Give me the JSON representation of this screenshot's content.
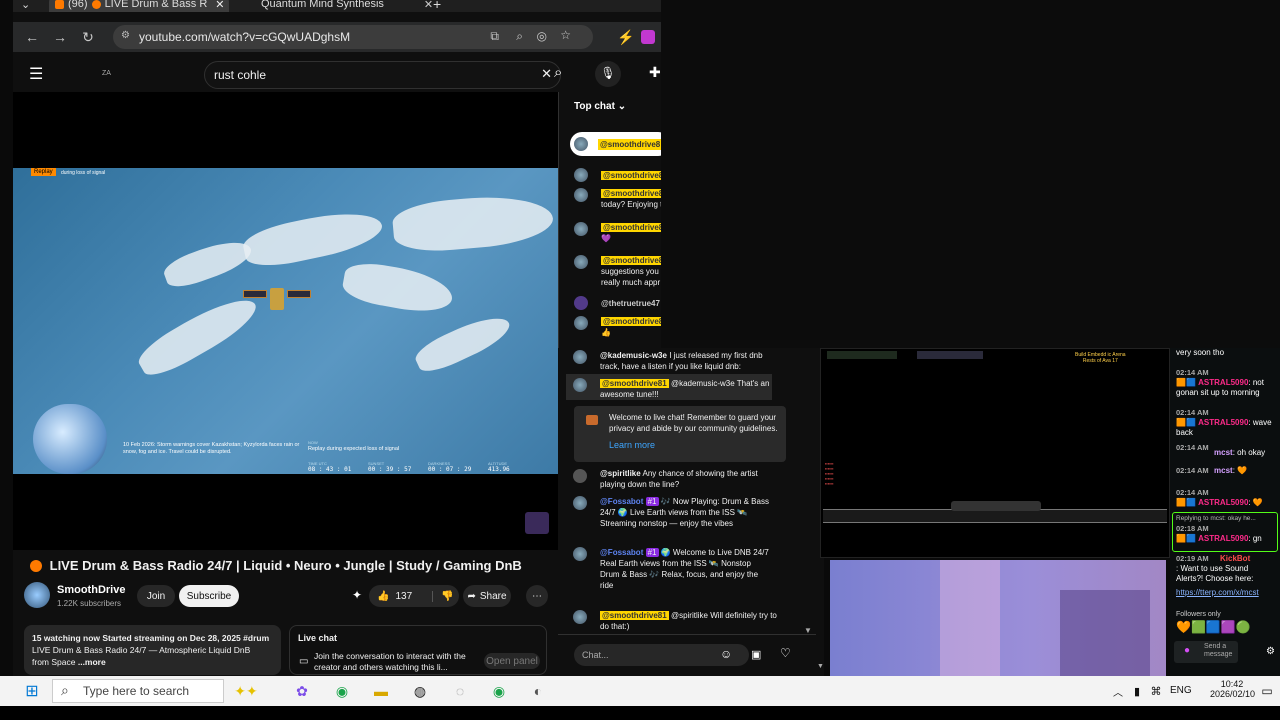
{
  "browser": {
    "tabs": [
      {
        "label": "(96)",
        "title": "LIVE Drum & Bass R"
      },
      {
        "label": "Quantum Mind Synthesis"
      }
    ],
    "url": "youtube.com/watch?v=cGQwUADghsM"
  },
  "youtube": {
    "logo_text": "ZA",
    "search_value": "rust cohle",
    "video": {
      "replay_badge": "Replay",
      "replay_sub": "during loss of signal",
      "overlay_info": "10 Feb 2026: Storm warnings cover Kazakhstan; Kyzylorda faces rain or snow, fog and ice. Travel could be disrupted.",
      "overlay_note_head": "NOW",
      "overlay_note": "Replay during expected loss of signal",
      "stats": [
        {
          "label": "TIME UTC",
          "value": "08 : 43 : 01"
        },
        {
          "label": "SUNSET",
          "value": "00 : 39 : 57"
        },
        {
          "label": "DARKNESS",
          "value": "00 : 07 : 29"
        },
        {
          "label": "ALTITUDE",
          "value": "413.96"
        }
      ]
    },
    "title": "LIVE Drum & Bass Radio 24/7 | Liquid • Neuro • Jungle | Study / Gaming DnB",
    "channel": {
      "name": "SmoothDrive",
      "subs": "1.22K subscribers"
    },
    "buttons": {
      "join": "Join",
      "subscribe": "Subscribe",
      "likes": "137",
      "share": "Share"
    },
    "description": {
      "line1": "15 watching now  Started streaming on Dec 28, 2025  #drum",
      "line2": "LIVE Drum & Bass Radio 24/7 — Atmospheric Liquid DnB",
      "line3": "from Space",
      "more": "...more"
    },
    "live_chat_box": {
      "title": "Live chat",
      "text": "Join the conversation to interact with the creator and others watching this li...",
      "open_panel": "Open panel"
    }
  },
  "chat": {
    "header": "Top chat",
    "messages": [
      {
        "name": "@smoothdrive8",
        "text": ""
      },
      {
        "name": "@smoothdrive8",
        "text": "today? Enjoying t"
      },
      {
        "name": "@smoothdrive8",
        "text": "💜"
      },
      {
        "name": "@smoothdrive8",
        "text": "suggestions you really much appr"
      },
      {
        "name": "@thetruetrue47",
        "text": ""
      },
      {
        "name": "@smoothdrive8",
        "text": "👍"
      }
    ],
    "wide_messages": [
      {
        "name": "@kademusic-w3e",
        "text": "I just released my first dnb track, have a listen if you like liquid dnb:"
      },
      {
        "name": "@smoothdrive81",
        "text": "@kademusic-w3e That's an awesome tune!!!"
      }
    ],
    "welcome": "Welcome to live chat! Remember to guard your privacy and abide by our community guidelines.",
    "learn_more": "Learn more",
    "msg_spirit": {
      "name": "@spiritlike",
      "text": "Any chance of showing the artist playing down the line?"
    },
    "fossabot1": {
      "name": "@Fossabot",
      "badge": "#1",
      "text": "🎶 Now Playing: Drum & Bass 24/7 🌍 Live Earth views from the ISS 🛰️ Streaming nonstop — enjoy the vibes"
    },
    "fossabot2": {
      "name": "@Fossabot",
      "badge": "#1",
      "text": "🌍 Welcome to Live DNB 24/7 Real Earth views from the ISS 🛰️ Nonstop Drum & Bass 🎶 Relax, focus, and enjoy the ride"
    },
    "msg_last": {
      "name": "@smoothdrive81",
      "text": "@spiritlike Will definitely try to do that:)"
    },
    "input_placeholder": "Chat..."
  },
  "kick": {
    "top": "very soon tho",
    "messages": [
      {
        "time": "02:14 AM",
        "name": "ASTRAL5090",
        "text": ": not gonan sit up to morning"
      },
      {
        "time": "02:14 AM",
        "name": "ASTRAL5090",
        "text": ": wave back"
      },
      {
        "time": "02:14 AM",
        "name": "mcst",
        "text": ": oh okay"
      },
      {
        "time": "02:14 AM",
        "name": "mcst",
        "text": ": 🧡"
      },
      {
        "time": "02:14 AM",
        "name": "ASTRAL5090",
        "text": ": 🧡"
      }
    ],
    "reply": "Replying to mcst: okay he...",
    "reply_msg": {
      "time": "02:18 AM",
      "name": "ASTRAL5090",
      "text": ": gn"
    },
    "bot": {
      "time": "02:19 AM",
      "name": "KickBot",
      "text": ": Want to use Sound Alerts?! Choose here:",
      "link": "https://tterp.com/x/mcst"
    },
    "followers": "Followers only",
    "send": "Send a message"
  },
  "twitch_small": {
    "line1": "Build Embedd ic Arena",
    "line2": "Rests of Ava 17"
  },
  "taskbar": {
    "search_placeholder": "Type here to search",
    "lang": "ENG",
    "time": "10:42",
    "date": "2026/02/10"
  }
}
